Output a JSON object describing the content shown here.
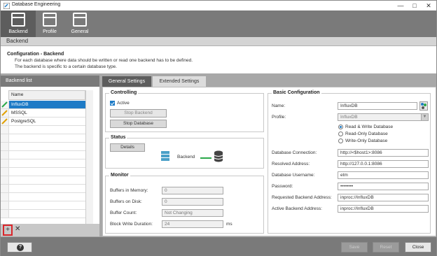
{
  "window": {
    "title": "Database Engineering",
    "minimize": "—",
    "maximize": "□",
    "close": "✕"
  },
  "nav": [
    {
      "label": "Backend",
      "icon": "backend-icon"
    },
    {
      "label": "Profile",
      "icon": "profile-icon"
    },
    {
      "label": "General",
      "icon": "general-icon"
    }
  ],
  "section_title": "Backend",
  "info": {
    "heading": "Configuration - Backend",
    "line1": "For each database where data should be written or read one backend has to be defined.",
    "line2": "The backend is specific to a certain database type."
  },
  "backend_list": {
    "title": "Backend list",
    "column": "Name",
    "rows": [
      {
        "name": "InfluxDB",
        "selected": true
      },
      {
        "name": "MSSQL",
        "selected": false
      },
      {
        "name": "PostgreSQL",
        "selected": false
      }
    ],
    "add": "+",
    "remove": "✕"
  },
  "tabs": [
    "General Settings",
    "Extended Settings"
  ],
  "controlling": {
    "title": "Controlling",
    "active_label": "Active",
    "stop_backend": "Stop Backend",
    "stop_database": "Stop Database"
  },
  "status": {
    "title": "Status",
    "details": "Details",
    "backend_label": "Backend"
  },
  "monitor": {
    "title": "Monitor",
    "buffers_memory_label": "Buffers in Memory:",
    "buffers_memory": "0",
    "buffers_disk_label": "Buffers on Disk:",
    "buffers_disk": "0",
    "buffer_count_label": "Buffer Count:",
    "buffer_count": "Not Changing",
    "block_write_label": "Block Write Duration:",
    "block_write": "24",
    "block_write_unit": "ms"
  },
  "basic": {
    "title": "Basic Configuration",
    "name_label": "Name:",
    "name": "InfluxDB",
    "profile_label": "Profile:",
    "profile": "InfluxDB",
    "mode_rw": "Read & Write Database",
    "mode_ro": "Read-Only Database",
    "mode_wo": "Write-Only Database",
    "db_conn_label": "Database Connection:",
    "db_conn": "http://<$host1>:8086",
    "resolved_label": "Resolved Address:",
    "resolved": "http://127.0.0.1:8086",
    "username_label": "Database Username:",
    "username": "etm",
    "password_label": "Password:",
    "password": "••••••••",
    "requested_label": "Requested Backend Address:",
    "requested": "inproc://InfluxDB",
    "active_label": "Active Backend Address:",
    "active": "inproc://InfluxDB"
  },
  "footer": {
    "help": "?",
    "save": "Save",
    "reset": "Reset",
    "close": "Close"
  },
  "colors": {
    "accent": "#1e7bc6",
    "nav_bg": "#7a7a7a",
    "nav_active": "#5d5d5d",
    "status_line": "#2aa84a"
  }
}
